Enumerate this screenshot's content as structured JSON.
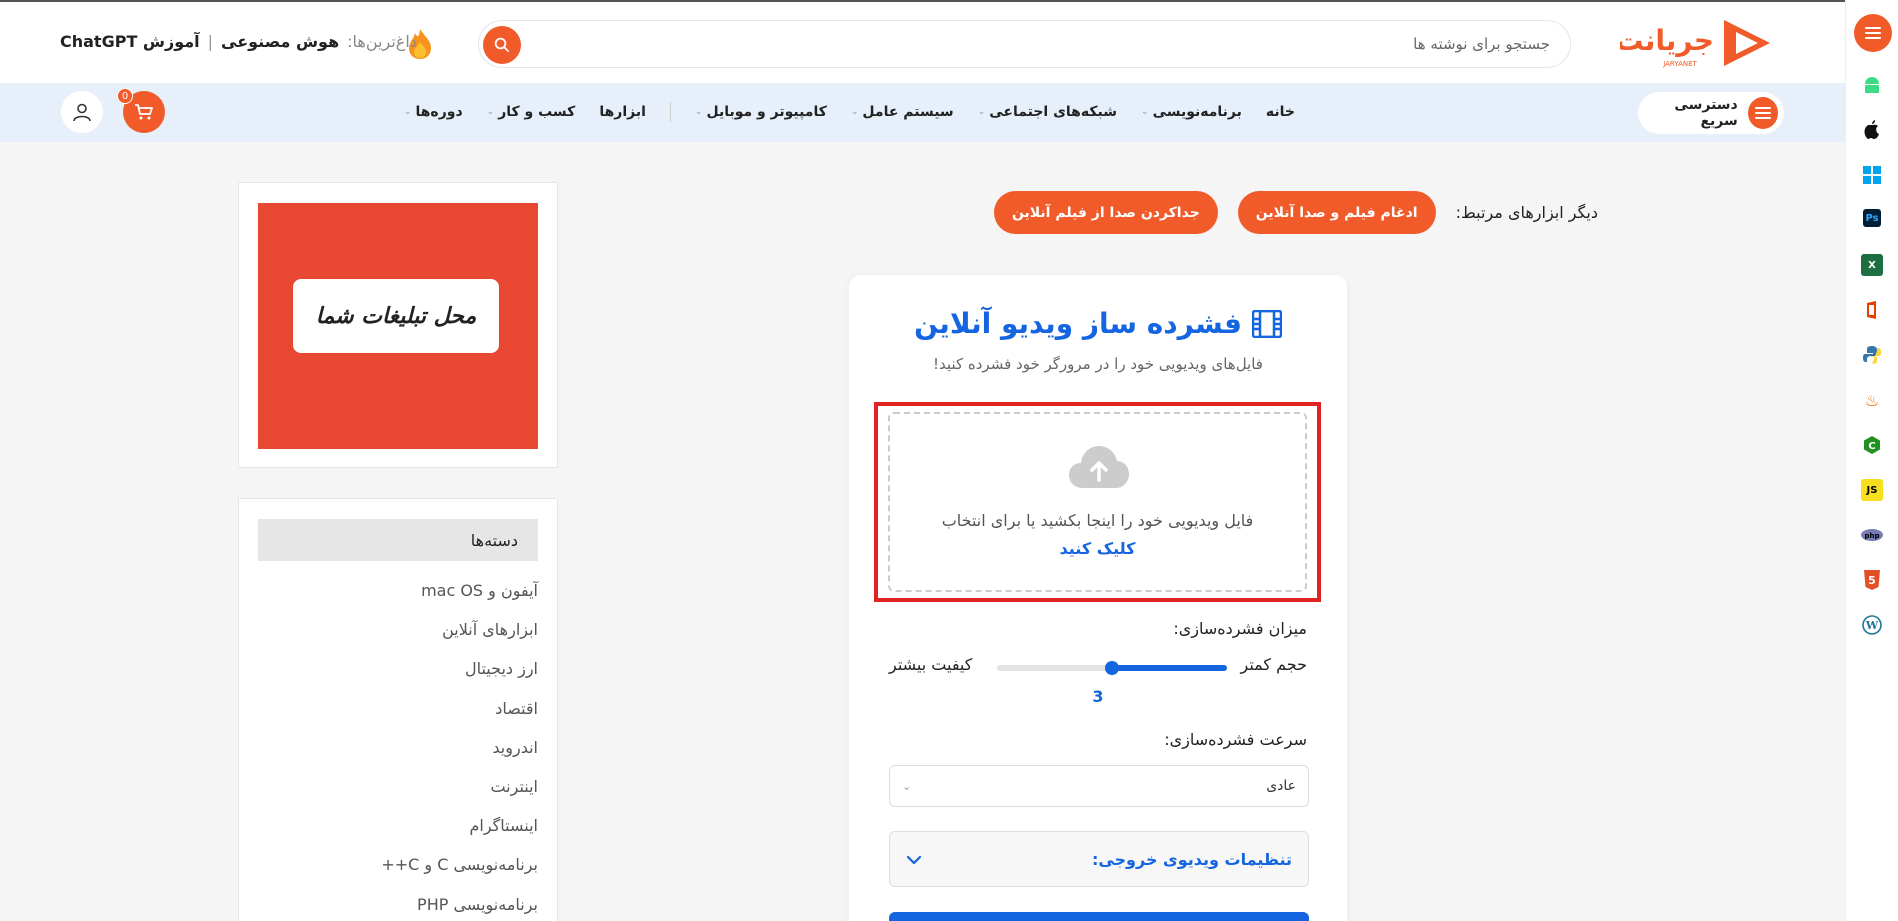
{
  "header": {
    "logo_text": "جریانت",
    "logo_sub": "JARYANET",
    "search_placeholder": "جستجو برای نوشته ها",
    "trending_label": "داغ‌ترین‌ها:",
    "trending": [
      "هوش مصنوعی",
      "آموزش ChatGPT"
    ]
  },
  "navbar": {
    "quick_access": "دسترسی سریع",
    "items": [
      {
        "label": "خانه",
        "dropdown": false
      },
      {
        "label": "برنامه‌نویسی",
        "dropdown": true
      },
      {
        "label": "شبکه‌های اجتماعی",
        "dropdown": true
      },
      {
        "label": "سیستم عامل",
        "dropdown": true
      },
      {
        "label": "کامپیوتر و موبایل",
        "dropdown": true
      },
      {
        "label": "ابزارها",
        "dropdown": false
      },
      {
        "label": "کسب و کار",
        "dropdown": true
      },
      {
        "label": "دوره‌ها",
        "dropdown": true
      }
    ],
    "cart_count": "0"
  },
  "related": {
    "label": "دیگر ابزارهای مرتبط:",
    "tools": [
      "ادغام فیلم و صدا آنلاین",
      "جداکردن صدا از فیلم آنلاین"
    ]
  },
  "tool": {
    "title": "فشرده ساز ویدیو آنلاین",
    "subtitle": "فایل‌های ویدیویی خود را در مرورگر خود فشرده کنید!",
    "drop_text": "فایل ویدیویی خود را اینجا بکشید یا برای انتخاب",
    "drop_link": "کلیک کنید",
    "compression_label": "میزان فشرده‌سازی:",
    "slider_low": "حجم کمتر",
    "slider_high": "کیفیت بیشتر",
    "slider_value": "3",
    "slider_fraction": 0.5,
    "speed_label": "سرعت فشرده‌سازی:",
    "speed_value": "عادی",
    "output_settings": "تنظیمات ویدیوی خروجی:"
  },
  "sidebar": {
    "ad_text": "محل تبلیغات شما",
    "categories_title": "دسته‌ها",
    "categories": [
      "آیفون و mac OS",
      "ابزارهای آنلاین",
      "ارز دیجیتال",
      "اقتصاد",
      "اندروید",
      "اینترنت",
      "اینستاگرام",
      "برنامه‌نویسی C و C++",
      "برنامه‌نویسی PHP"
    ]
  },
  "rail": {
    "icons": [
      "android-icon",
      "apple-icon",
      "windows-icon",
      "photoshop-icon",
      "excel-icon",
      "office-icon",
      "python-icon",
      "java-icon",
      "csharp-icon",
      "javascript-icon",
      "php-icon",
      "html5-icon",
      "wordpress-icon"
    ]
  },
  "colors": {
    "accent": "#f15a29",
    "primary": "#1565e0",
    "highlight": "#e02424"
  }
}
